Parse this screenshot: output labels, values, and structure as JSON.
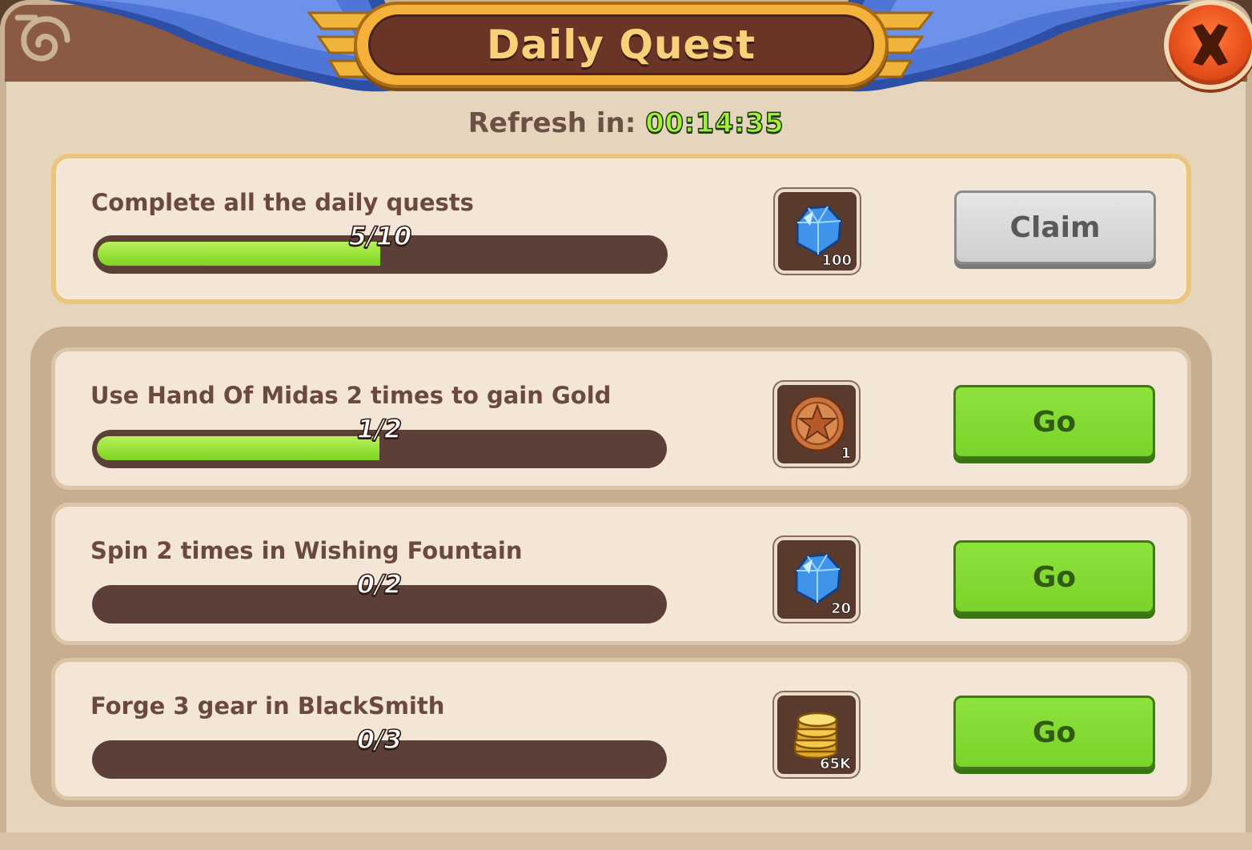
{
  "header": {
    "title": "Daily Quest",
    "refresh_label": "Refresh in:",
    "refresh_time": "00:14:35"
  },
  "featured": {
    "label": "Complete all the daily quests",
    "progress_text": "5/10",
    "progress_fraction": 0.5,
    "reward": {
      "icon": "gem-icon",
      "count": "100"
    },
    "button": "Claim"
  },
  "quests": [
    {
      "label": "Use Hand Of Midas 2 times to gain Gold",
      "progress_text": "1/2",
      "progress_fraction": 0.5,
      "reward": {
        "icon": "star-coin-icon",
        "count": "1"
      },
      "button": "Go"
    },
    {
      "label": "Spin 2 times in Wishing Fountain",
      "progress_text": "0/2",
      "progress_fraction": 0,
      "reward": {
        "icon": "gem-icon",
        "count": "20"
      },
      "button": "Go"
    },
    {
      "label": "Forge 3 gear in BlackSmith",
      "progress_text": "0/3",
      "progress_fraction": 0,
      "reward": {
        "icon": "gold-coins-icon",
        "count": "65K"
      },
      "button": "Go"
    }
  ],
  "colors": {
    "panel": "#e6d5bd",
    "title_bg": "#6a3526",
    "title_text": "#f8d27a",
    "go_button": "#7ed321",
    "claim_button": "#d6d6d6",
    "progress_track": "#5c3f36",
    "progress_fill": "#7ed321",
    "timer": "#a3ee3a",
    "close_button": "#e8501c"
  }
}
